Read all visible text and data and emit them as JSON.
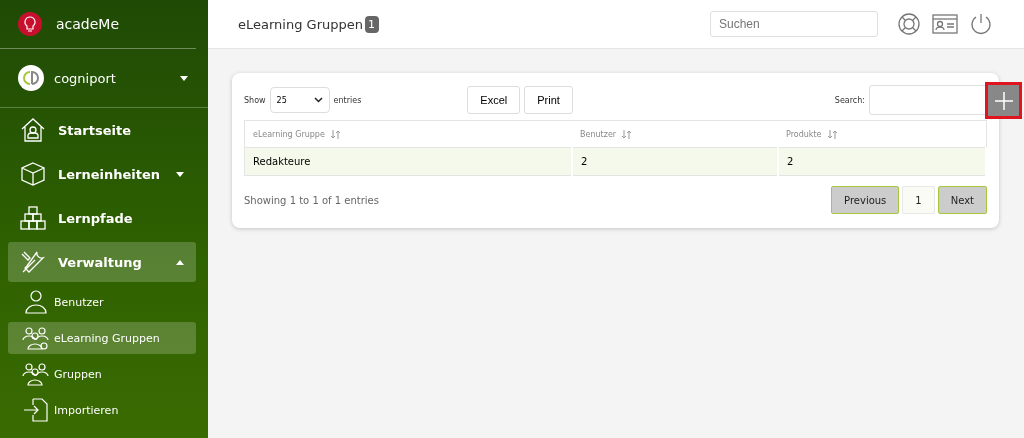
{
  "sidebar": {
    "brand": "acadeMe",
    "account": "cogniport",
    "items": [
      {
        "label": "Startseite",
        "kind": "link",
        "selected": false
      },
      {
        "label": "Lerneinheiten",
        "kind": "group",
        "expanded": false,
        "selected": false
      },
      {
        "label": "Lernpfade",
        "kind": "link",
        "selected": false
      },
      {
        "label": "Verwaltung",
        "kind": "group",
        "expanded": true,
        "selected": true,
        "children": [
          {
            "label": "Benutzer",
            "selected": false
          },
          {
            "label": "eLearning Gruppen",
            "selected": true
          },
          {
            "label": "Gruppen",
            "selected": false
          },
          {
            "label": "Importieren",
            "selected": false
          }
        ]
      }
    ]
  },
  "header": {
    "title": "eLearning Gruppen",
    "count": "1",
    "search": {
      "placeholder": "Suchen"
    }
  },
  "table": {
    "length_label_before": "Show",
    "length_value": "25",
    "length_label_after": "entries",
    "buttons": [
      "Excel",
      "Print"
    ],
    "search_label": "Search:",
    "columns": [
      "eLearning Gruppe",
      "Benutzer",
      "Produkte"
    ],
    "rows": [
      [
        "Redakteure",
        "2",
        "2"
      ]
    ],
    "info": "Showing 1 to 1 of 1 entries",
    "pagination": [
      {
        "label": "Previous",
        "selected": false
      },
      {
        "label": "1",
        "selected": true
      },
      {
        "label": "Next",
        "selected": false
      }
    ]
  }
}
